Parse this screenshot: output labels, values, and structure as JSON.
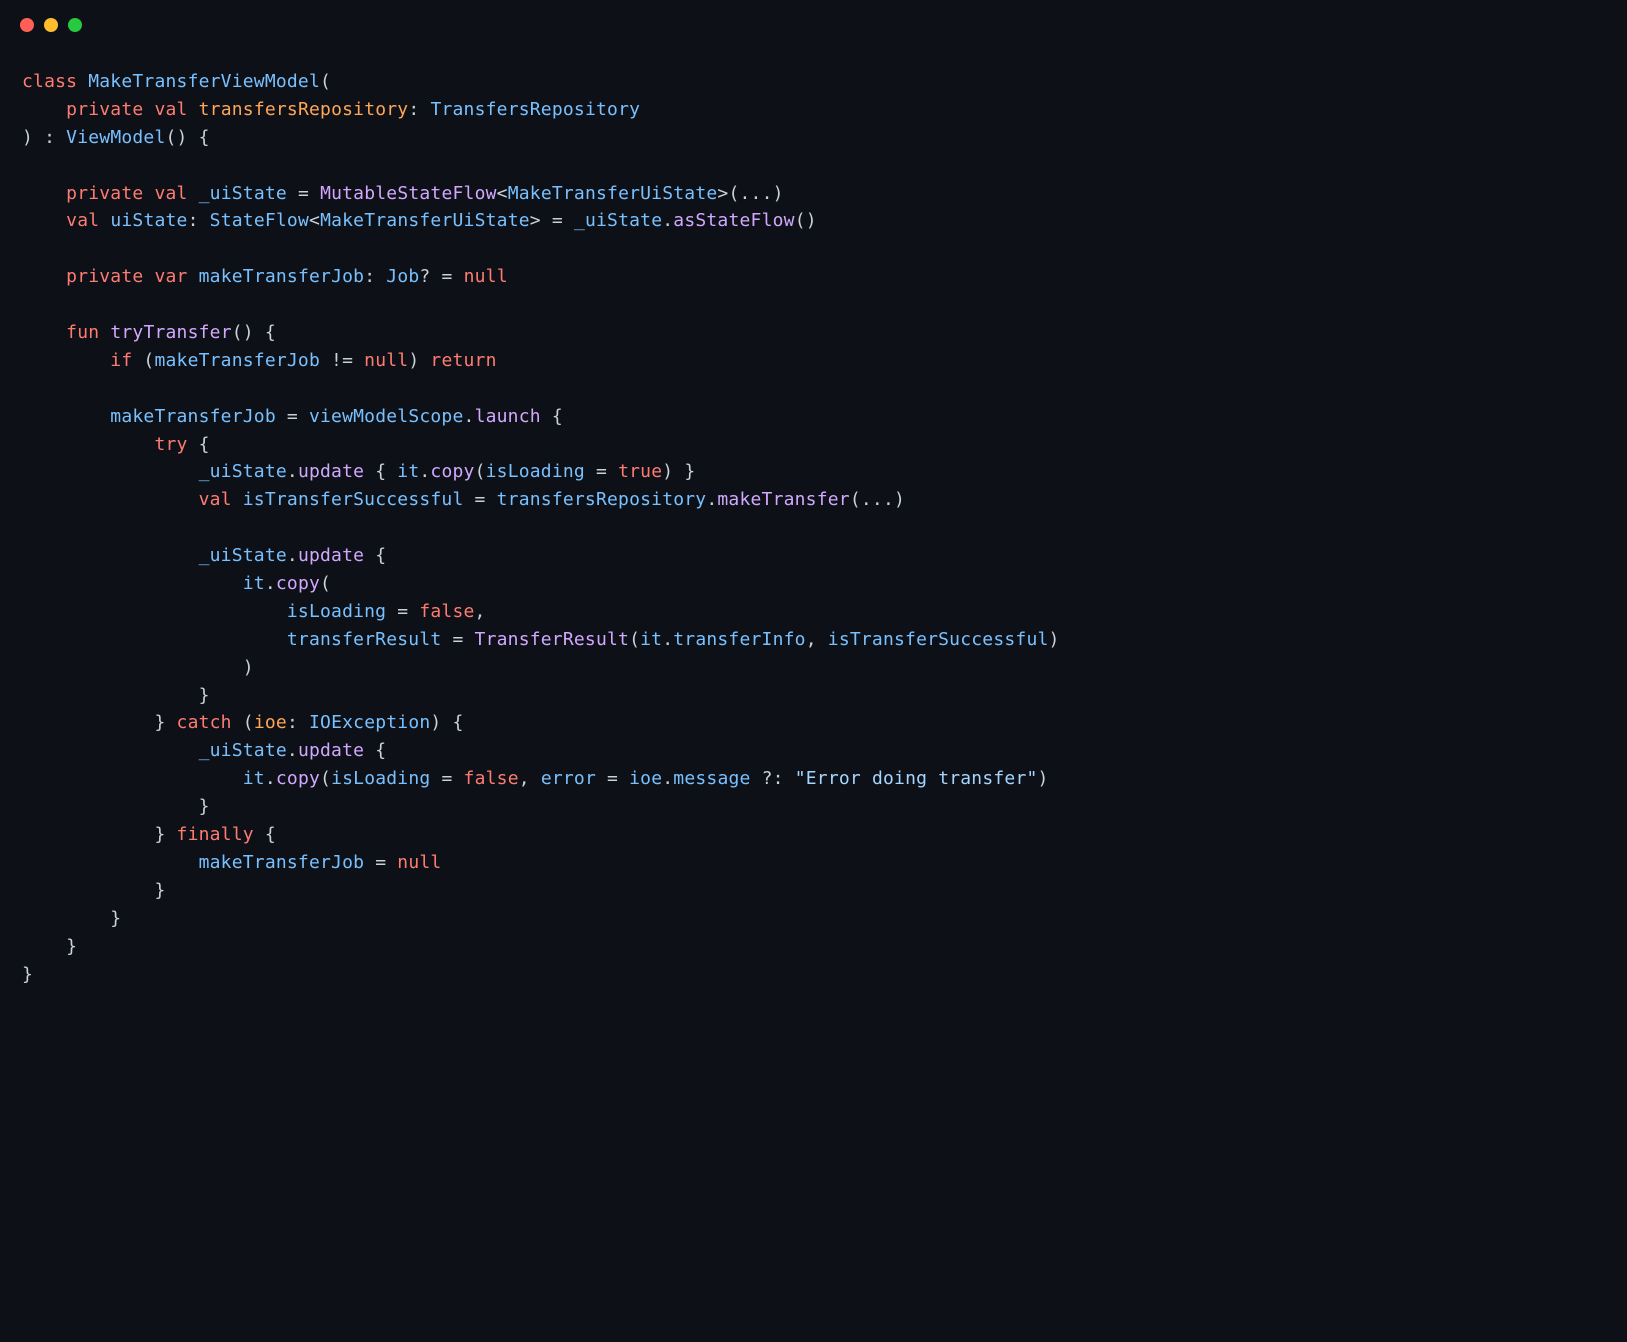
{
  "titlebar": {
    "buttons": [
      "close",
      "minimize",
      "zoom"
    ]
  },
  "code": {
    "t01_class": "class",
    "t01_name": "MakeTransferViewModel",
    "t01_p1": "(",
    "t02_priv": "private",
    "t02_val": "val",
    "t02_param": "transfersRepository",
    "t02_colon": ":",
    "t02_type": "TransfersRepository",
    "t03_p2": ")",
    "t03_colon": " : ",
    "t03_super": "ViewModel",
    "t03_call": "()",
    "t03_brace": " {",
    "t05_priv": "private",
    "t05_val": "val",
    "t05_name": "_uiState",
    "t05_eq": " = ",
    "t05_fn": "MutableStateFlow",
    "t05_lt": "<",
    "t05_gen": "MakeTransferUiState",
    "t05_gt": ">",
    "t05_args": "(...)",
    "t06_val": "val",
    "t06_name": "uiState",
    "t06_colon": ": ",
    "t06_type1": "StateFlow",
    "t06_lt": "<",
    "t06_gen": "MakeTransferUiState",
    "t06_gt": ">",
    "t06_eq": " = ",
    "t06_src": "_uiState",
    "t06_dot": ".",
    "t06_fn": "asStateFlow",
    "t06_call": "()",
    "t08_priv": "private",
    "t08_var": "var",
    "t08_name": "makeTransferJob",
    "t08_colon": ": ",
    "t08_type": "Job",
    "t08_q": "?",
    "t08_eq": " = ",
    "t08_null": "null",
    "t10_fun": "fun",
    "t10_name": "tryTransfer",
    "t10_sig": "() {",
    "t11_if": "if",
    "t11_open": " (",
    "t11_id": "makeTransferJob",
    "t11_op": " != ",
    "t11_null": "null",
    "t11_close": ") ",
    "t11_ret": "return",
    "t13_lhs": "makeTransferJob",
    "t13_eq": " = ",
    "t13_scope": "viewModelScope",
    "t13_dot": ".",
    "t13_launch": "launch",
    "t13_brace": " {",
    "t14_try": "try",
    "t14_brace": " {",
    "t15_ui": "_uiState",
    "t15_dot": ".",
    "t15_upd": "update",
    "t15_open": " { ",
    "t15_it": "it",
    "t15_dot2": ".",
    "t15_copy": "copy",
    "t15_po": "(",
    "t15_arg": "isLoading",
    "t15_eq": " = ",
    "t15_true": "true",
    "t15_pc": ")",
    "t15_close": " }",
    "t16_val": "val",
    "t16_name": "isTransferSuccessful",
    "t16_eq": " = ",
    "t16_repo": "transfersRepository",
    "t16_dot": ".",
    "t16_fn": "makeTransfer",
    "t16_args": "(...)",
    "t18_ui": "_uiState",
    "t18_dot": ".",
    "t18_upd": "update",
    "t18_brace": " {",
    "t19_it": "it",
    "t19_dot": ".",
    "t19_copy": "copy",
    "t19_po": "(",
    "t20_arg": "isLoading",
    "t20_eq": " = ",
    "t20_false": "false",
    "t20_comma": ",",
    "t21_arg": "transferResult",
    "t21_eq": " = ",
    "t21_ctor": "TransferResult",
    "t21_po": "(",
    "t21_it": "it",
    "t21_dot": ".",
    "t21_prop": "transferInfo",
    "t21_comma": ", ",
    "t21_var": "isTransferSuccessful",
    "t21_pc": ")",
    "t22_pc": ")",
    "t23_brace": "}",
    "t24_brace": "}",
    "t24_catch": " catch ",
    "t24_po": "(",
    "t24_ex": "ioe",
    "t24_colon": ": ",
    "t24_type": "IOException",
    "t24_pc": ")",
    "t24_ob": " {",
    "t25_ui": "_uiState",
    "t25_dot": ".",
    "t25_upd": "update",
    "t25_brace": " {",
    "t26_it": "it",
    "t26_dot": ".",
    "t26_copy": "copy",
    "t26_po": "(",
    "t26_arg1": "isLoading",
    "t26_eq1": " = ",
    "t26_false": "false",
    "t26_comma": ", ",
    "t26_arg2": "error",
    "t26_eq2": " = ",
    "t26_ioe": "ioe",
    "t26_dot2": ".",
    "t26_msg": "message",
    "t26_elvis": " ?: ",
    "t26_str": "\"Error doing transfer\"",
    "t26_pc": ")",
    "t27_brace": "}",
    "t28_brace": "}",
    "t28_finally": " finally ",
    "t28_ob": "{",
    "t29_lhs": "makeTransferJob",
    "t29_eq": " = ",
    "t29_null": "null",
    "t30_brace": "}",
    "t31_brace": "}",
    "t32_brace": "}",
    "t33_brace": "}"
  }
}
